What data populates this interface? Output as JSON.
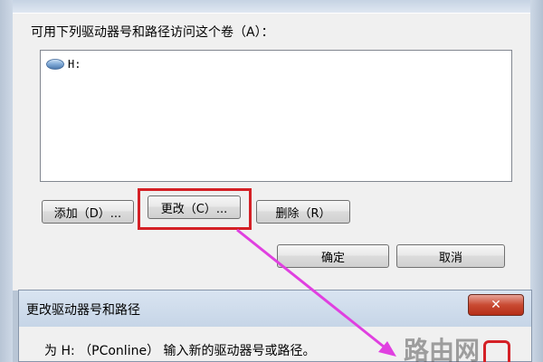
{
  "main_dialog": {
    "header": "可用下列驱动器号和路径访问这个卷（A）：",
    "list_items": [
      {
        "label": "H:",
        "icon": "drive-icon"
      }
    ],
    "buttons": {
      "add": "添加（D）...",
      "change": "更改（C）...",
      "remove": "删除（R）",
      "ok": "确定",
      "cancel": "取消"
    }
  },
  "child_dialog": {
    "title": "更改驱动器号和路径",
    "close_symbol": "✕",
    "text": "为 H: （PConline） 输入新的驱动器号或路径。"
  },
  "watermark": {
    "text": "路由网"
  },
  "colors": {
    "highlight": "#d42026",
    "arrow": "#e040e0"
  }
}
